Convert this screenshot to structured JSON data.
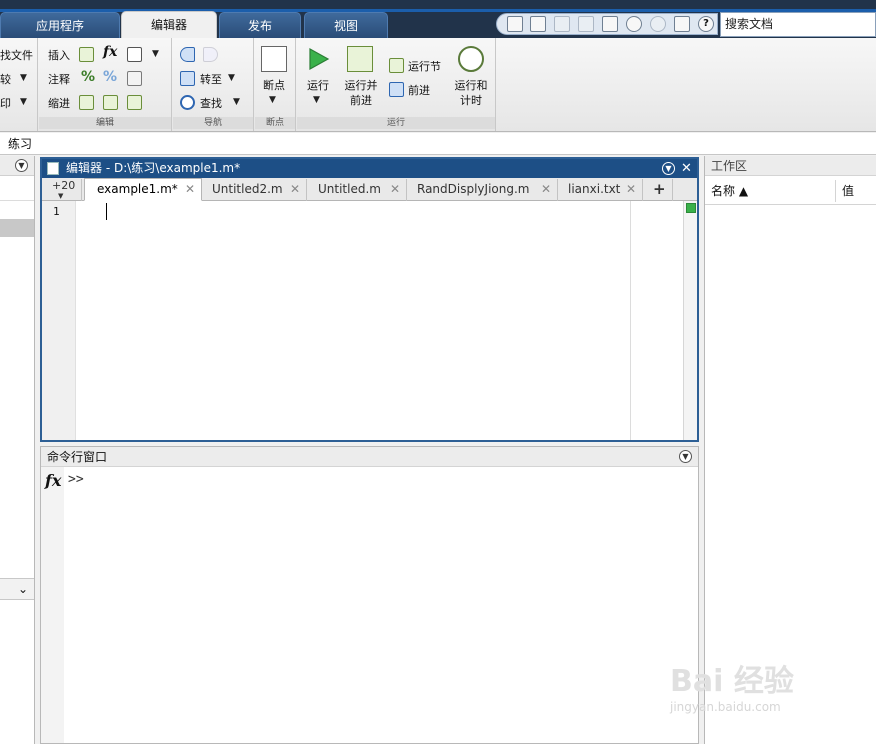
{
  "ribbon_tabs": [
    {
      "label": "应用程序"
    },
    {
      "label": "编辑器"
    },
    {
      "label": "发布"
    },
    {
      "label": "视图"
    }
  ],
  "search": {
    "value": "搜索文档"
  },
  "ribbon": {
    "file_group": {
      "item1": "找文件",
      "item2": "较",
      "item3": "印"
    },
    "edit_group": {
      "title": "编辑",
      "insert": "插入",
      "comment": "注释",
      "indent": "缩进",
      "fx": "fx"
    },
    "nav_group": {
      "title": "导航",
      "goto": "转至",
      "find": "查找"
    },
    "breakpoint_group": {
      "title": "断点",
      "breakpoints": "断点"
    },
    "run_group": {
      "title": "运行",
      "run": "运行",
      "run_advance_1": "运行并",
      "run_advance_2": "前进",
      "run_section": "运行节",
      "advance": "前进",
      "run_time_1": "运行和",
      "run_time_2": "计时"
    }
  },
  "path": {
    "text": "练习"
  },
  "editor": {
    "title": "编辑器 - D:\\练习\\example1.m*",
    "zoom": "+20",
    "tabs": [
      {
        "label": "example1.m*"
      },
      {
        "label": "Untitled2.m"
      },
      {
        "label": "Untitled.m"
      },
      {
        "label": "RandDisplyJiong.m"
      },
      {
        "label": "lianxi.txt"
      }
    ],
    "add_tab": "+",
    "line_number": "1"
  },
  "command_window": {
    "title": "命令行窗口",
    "fx": "fx",
    "prompt": ">>"
  },
  "workspace": {
    "title": "工作区",
    "col_name": "名称 ▲",
    "col_value": "值"
  },
  "watermark": {
    "text": "Bai 经验",
    "sub": "jingyan.baidu.com"
  },
  "colors": {
    "titlebar": "#1d4f86",
    "tabstrip": "#21334a",
    "run_green": "#3ab14a"
  }
}
